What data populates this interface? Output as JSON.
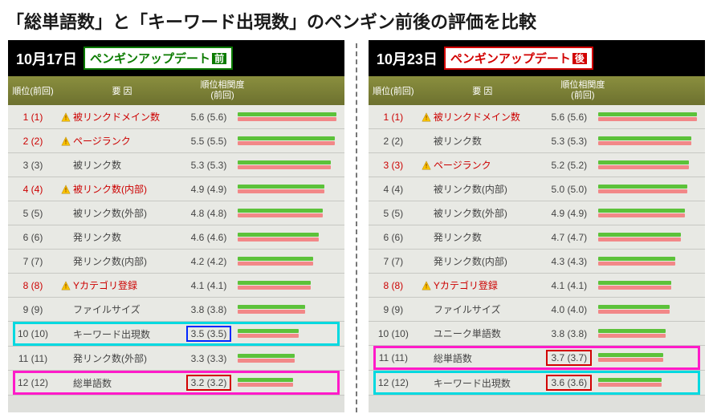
{
  "title": "「総単語数」と「キーワード出現数」のペンギン前後の評価を比較",
  "left": {
    "date": "10月17日",
    "badge_prefix": "ペンギンアップデート",
    "badge_box": "前",
    "header": {
      "rank": "順位(前回)",
      "factor": "要 因",
      "corr": "順位相関度\n(前回)"
    },
    "rows": [
      {
        "rank": "1 (1)",
        "warn": true,
        "factor": "被リンクドメイン数",
        "corr": "5.6 (5.6)",
        "red": true,
        "g": 100,
        "p": 100,
        "ob": "",
        "hl": ""
      },
      {
        "rank": "2 (2)",
        "warn": true,
        "factor": "ページランク",
        "corr": "5.5 (5.5)",
        "red": true,
        "g": 98,
        "p": 98,
        "ob": "",
        "hl": ""
      },
      {
        "rank": "3 (3)",
        "warn": false,
        "factor": "被リンク数",
        "corr": "5.3 (5.3)",
        "red": false,
        "g": 94,
        "p": 94,
        "ob": "",
        "hl": ""
      },
      {
        "rank": "4 (4)",
        "warn": true,
        "factor": "被リンク数(内部)",
        "corr": "4.9 (4.9)",
        "red": true,
        "g": 88,
        "p": 88,
        "ob": "",
        "hl": ""
      },
      {
        "rank": "5 (5)",
        "warn": false,
        "factor": "被リンク数(外部)",
        "corr": "4.8 (4.8)",
        "red": false,
        "g": 86,
        "p": 86,
        "ob": "",
        "hl": ""
      },
      {
        "rank": "6 (6)",
        "warn": false,
        "factor": "発リンク数",
        "corr": "4.6 (4.6)",
        "red": false,
        "g": 82,
        "p": 82,
        "ob": "",
        "hl": ""
      },
      {
        "rank": "7 (7)",
        "warn": false,
        "factor": "発リンク数(内部)",
        "corr": "4.2 (4.2)",
        "red": false,
        "g": 76,
        "p": 76,
        "ob": "",
        "hl": ""
      },
      {
        "rank": "8 (8)",
        "warn": true,
        "factor": "Yカテゴリ登録",
        "corr": "4.1 (4.1)",
        "red": true,
        "g": 74,
        "p": 74,
        "ob": "",
        "hl": ""
      },
      {
        "rank": "9 (9)",
        "warn": false,
        "factor": "ファイルサイズ",
        "corr": "3.8 (3.8)",
        "red": false,
        "g": 68,
        "p": 68,
        "ob": "",
        "hl": ""
      },
      {
        "rank": "10 (10)",
        "warn": false,
        "factor": "キーワード出現数",
        "corr": "3.5 (3.5)",
        "red": false,
        "g": 62,
        "p": 62,
        "ob": "blue",
        "hl": "cyan"
      },
      {
        "rank": "11 (11)",
        "warn": false,
        "factor": "発リンク数(外部)",
        "corr": "3.3 (3.3)",
        "red": false,
        "g": 58,
        "p": 58,
        "ob": "",
        "hl": ""
      },
      {
        "rank": "12 (12)",
        "warn": false,
        "factor": "総単語数",
        "corr": "3.2 (3.2)",
        "red": false,
        "g": 56,
        "p": 56,
        "ob": "red",
        "hl": "magenta"
      }
    ]
  },
  "right": {
    "date": "10月23日",
    "badge_prefix": "ペンギンアップデート",
    "badge_box": "後",
    "header": {
      "rank": "順位(前回)",
      "factor": "要 因",
      "corr": "順位相関度\n(前回)"
    },
    "rows": [
      {
        "rank": "1 (1)",
        "warn": true,
        "factor": "被リンクドメイン数",
        "corr": "5.6 (5.6)",
        "red": true,
        "g": 100,
        "p": 100,
        "ob": "",
        "hl": ""
      },
      {
        "rank": "2 (2)",
        "warn": false,
        "factor": "被リンク数",
        "corr": "5.3 (5.3)",
        "red": false,
        "g": 94,
        "p": 94,
        "ob": "",
        "hl": ""
      },
      {
        "rank": "3 (3)",
        "warn": true,
        "factor": "ページランク",
        "corr": "5.2 (5.2)",
        "red": true,
        "g": 92,
        "p": 92,
        "ob": "",
        "hl": ""
      },
      {
        "rank": "4 (4)",
        "warn": false,
        "factor": "被リンク数(内部)",
        "corr": "5.0 (5.0)",
        "red": false,
        "g": 90,
        "p": 90,
        "ob": "",
        "hl": ""
      },
      {
        "rank": "5 (5)",
        "warn": false,
        "factor": "被リンク数(外部)",
        "corr": "4.9 (4.9)",
        "red": false,
        "g": 88,
        "p": 88,
        "ob": "",
        "hl": ""
      },
      {
        "rank": "6 (6)",
        "warn": false,
        "factor": "発リンク数",
        "corr": "4.7 (4.7)",
        "red": false,
        "g": 84,
        "p": 84,
        "ob": "",
        "hl": ""
      },
      {
        "rank": "7 (7)",
        "warn": false,
        "factor": "発リンク数(内部)",
        "corr": "4.3 (4.3)",
        "red": false,
        "g": 78,
        "p": 78,
        "ob": "",
        "hl": ""
      },
      {
        "rank": "8 (8)",
        "warn": true,
        "factor": "Yカテゴリ登録",
        "corr": "4.1 (4.1)",
        "red": true,
        "g": 74,
        "p": 74,
        "ob": "",
        "hl": ""
      },
      {
        "rank": "9 (9)",
        "warn": false,
        "factor": "ファイルサイズ",
        "corr": "4.0 (4.0)",
        "red": false,
        "g": 72,
        "p": 72,
        "ob": "",
        "hl": ""
      },
      {
        "rank": "10 (10)",
        "warn": false,
        "factor": "ユニーク単語数",
        "corr": "3.8 (3.8)",
        "red": false,
        "g": 68,
        "p": 68,
        "ob": "",
        "hl": ""
      },
      {
        "rank": "11 (11)",
        "warn": false,
        "factor": "総単語数",
        "corr": "3.7 (3.7)",
        "red": false,
        "g": 66,
        "p": 66,
        "ob": "red",
        "hl": "magenta"
      },
      {
        "rank": "12 (12)",
        "warn": false,
        "factor": "キーワード出現数",
        "corr": "3.6 (3.6)",
        "red": false,
        "g": 64,
        "p": 64,
        "ob": "red",
        "hl": "cyan"
      }
    ]
  }
}
